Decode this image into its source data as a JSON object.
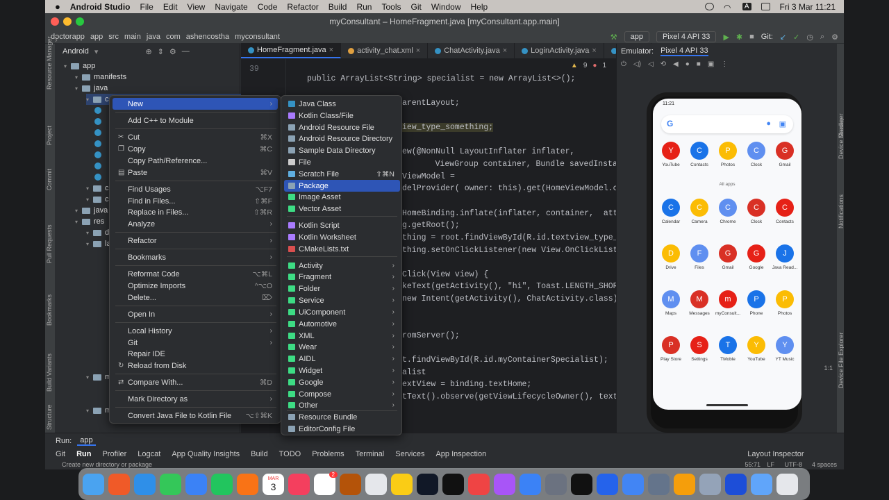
{
  "menubar": {
    "app": "Android Studio",
    "items": [
      "File",
      "Edit",
      "View",
      "Navigate",
      "Code",
      "Refactor",
      "Build",
      "Run",
      "Tools",
      "Git",
      "Window",
      "Help"
    ],
    "clock": "Fri 3 Mar  11:21",
    "input_badge": "A"
  },
  "window": {
    "title": "myConsultant – HomeFragment.java [myConsultant.app.main]"
  },
  "breadcrumb": [
    "doctorapp",
    "app",
    "src",
    "main",
    "java",
    "com",
    "ashencostha",
    "myconsultant"
  ],
  "toolbar": {
    "config": "app",
    "device": "Pixel 4 API 33",
    "git_label": "Git:"
  },
  "project": {
    "view": "Android",
    "rows": [
      {
        "label": "app",
        "indent": 0,
        "kind": "folder"
      },
      {
        "label": "manifests",
        "indent": 1,
        "kind": "folder"
      },
      {
        "label": "java",
        "indent": 1,
        "kind": "folder"
      },
      {
        "label": "co",
        "indent": 2,
        "kind": "folder"
      },
      {
        "label": "co",
        "indent": 2,
        "kind": "folder"
      },
      {
        "label": "co",
        "indent": 2,
        "kind": "folder"
      },
      {
        "label": "java",
        "indent": 1,
        "kind": "folder"
      },
      {
        "label": "res",
        "indent": 1,
        "kind": "folder"
      },
      {
        "label": "dra",
        "indent": 2,
        "kind": "folder"
      },
      {
        "label": "lay",
        "indent": 2,
        "kind": "folder"
      },
      {
        "label": "me",
        "indent": 2,
        "kind": "folder"
      },
      {
        "label": "mi",
        "indent": 2,
        "kind": "folder"
      }
    ],
    "side_labels": [
      "Resource Manager",
      "Project",
      "Commit",
      "Pull Requests",
      "Bookmarks",
      "Build Variants",
      "Structure"
    ]
  },
  "tabs": [
    "HomeFragment.java",
    "activity_chat.xml",
    "ChatActivity.java",
    "LoginActivity.java",
    "Main"
  ],
  "editor": {
    "first_line_no": "39",
    "warnings": "9",
    "errors": "1",
    "lines": [
      "public ArrayList<String> specialist = new ArrayList<>();",
      "arentLayout;",
      "iew_type_something;",
      "ew(@NonNull LayoutInflater inflater,",
      "    ViewGroup container, Bundle savedInstanceState",
      "ViewModel =",
      "delProvider( owner: this).get(HomeViewModel.class)",
      "HomeBinding.inflate(inflater, container,  attachTo",
      "g.getRoot();",
      "thing = root.findViewById(R.id.textview_type_some",
      "thing.setOnClickListener(new View.OnClickListener",
      "Click(View view) {",
      "keText(getActivity(), \"hi\", Toast.LENGTH_SHORT).s",
      "new Intent(getActivity(), ChatActivity.class));",
      "romServer();",
      "t.findViewById(R.id.myContainerSpecialist);",
      "alist",
      "extView = binding.textHome;",
      "tText().observe(getViewLifecycleOwner(), textView"
    ]
  },
  "emulator": {
    "label": "Emulator:",
    "device": "Pixel 4 API 33",
    "right_labels": [
      "Gradle",
      "Device Manager",
      "Notifications",
      "Device File Explorer",
      "Emulator"
    ],
    "zoom": "1:1"
  },
  "phone": {
    "time": "11:21",
    "all_apps": "All apps",
    "apps": [
      [
        "YouTube",
        "Contacts",
        "Photos",
        "Clock",
        "Gmail"
      ],
      [
        "Calendar",
        "Camera",
        "Chrome",
        "Clock",
        "Contacts"
      ],
      [
        "Drive",
        "Files",
        "Gmail",
        "Google",
        "Java Read..."
      ],
      [
        "Maps",
        "Messages",
        "myConsult...",
        "Phone",
        "Photos"
      ],
      [
        "Play Store",
        "Settings",
        "TMoble",
        "YouTube",
        "YT Music"
      ]
    ],
    "colors": [
      "#e62117",
      "#1a73e8",
      "#fbbc04",
      "#5f8ff0",
      "#d93025"
    ]
  },
  "context_menu": {
    "items": [
      {
        "label": "New",
        "shortcut": "",
        "submenu": true,
        "selected": true
      },
      {
        "label": "Add C++ to Module",
        "shortcut": ""
      },
      {
        "label": "Cut",
        "shortcut": "⌘X",
        "icon": "✂"
      },
      {
        "label": "Copy",
        "shortcut": "⌘C",
        "icon": "❐"
      },
      {
        "label": "Copy Path/Reference...",
        "shortcut": ""
      },
      {
        "label": "Paste",
        "shortcut": "⌘V",
        "icon": "▤"
      },
      {
        "label": "Find Usages",
        "shortcut": "⌥F7"
      },
      {
        "label": "Find in Files...",
        "shortcut": "⇧⌘F"
      },
      {
        "label": "Replace in Files...",
        "shortcut": "⇧⌘R"
      },
      {
        "label": "Analyze",
        "shortcut": "",
        "submenu": true
      },
      {
        "label": "Refactor",
        "shortcut": "",
        "submenu": true
      },
      {
        "label": "Bookmarks",
        "shortcut": "",
        "submenu": true
      },
      {
        "label": "Reformat Code",
        "shortcut": "⌥⌘L"
      },
      {
        "label": "Optimize Imports",
        "shortcut": "^⌥O"
      },
      {
        "label": "Delete...",
        "shortcut": "⌦"
      },
      {
        "label": "Open In",
        "shortcut": "",
        "submenu": true
      },
      {
        "label": "Local History",
        "shortcut": "",
        "submenu": true
      },
      {
        "label": "Git",
        "shortcut": "",
        "submenu": true
      },
      {
        "label": "Repair IDE",
        "shortcut": ""
      },
      {
        "label": "Reload from Disk",
        "shortcut": "",
        "icon": "↻"
      },
      {
        "label": "Compare With...",
        "shortcut": "⌘D",
        "icon": "⇄"
      },
      {
        "label": "Mark Directory as",
        "shortcut": "",
        "submenu": true
      },
      {
        "label": "Convert Java File to Kotlin File",
        "shortcut": "⌥⇧⌘K"
      }
    ]
  },
  "new_submenu": {
    "items": [
      {
        "label": "Java Class",
        "icon": "#3592c4"
      },
      {
        "label": "Kotlin Class/File",
        "icon": "#a97bff"
      },
      {
        "label": "Android Resource File",
        "icon": "#8ba2b4"
      },
      {
        "label": "Android Resource Directory",
        "icon": "#8ba2b4"
      },
      {
        "label": "Sample Data Directory",
        "icon": "#8ba2b4"
      },
      {
        "label": "File",
        "icon": "#cccccc"
      },
      {
        "label": "Scratch File",
        "icon": "#5faee0",
        "shortcut": "⇧⌘N"
      },
      {
        "label": "Package",
        "icon": "#8ba2b4",
        "selected": true
      },
      {
        "label": "Image Asset",
        "icon": "#3ddc84"
      },
      {
        "label": "Vector Asset",
        "icon": "#3ddc84"
      },
      {
        "label": "Kotlin Script",
        "icon": "#a97bff"
      },
      {
        "label": "Kotlin Worksheet",
        "icon": "#a97bff"
      },
      {
        "label": "CMakeLists.txt",
        "icon": "#d94f4f"
      },
      {
        "label": "Activity",
        "icon": "#3ddc84",
        "submenu": true
      },
      {
        "label": "Fragment",
        "icon": "#3ddc84",
        "submenu": true
      },
      {
        "label": "Folder",
        "icon": "#3ddc84",
        "submenu": true
      },
      {
        "label": "Service",
        "icon": "#3ddc84",
        "submenu": true
      },
      {
        "label": "UiComponent",
        "icon": "#3ddc84",
        "submenu": true
      },
      {
        "label": "Automotive",
        "icon": "#3ddc84",
        "submenu": true
      },
      {
        "label": "XML",
        "icon": "#3ddc84",
        "submenu": true
      },
      {
        "label": "Wear",
        "icon": "#3ddc84",
        "submenu": true
      },
      {
        "label": "AIDL",
        "icon": "#3ddc84",
        "submenu": true
      },
      {
        "label": "Widget",
        "icon": "#3ddc84",
        "submenu": true
      },
      {
        "label": "Google",
        "icon": "#3ddc84",
        "submenu": true
      },
      {
        "label": "Compose",
        "icon": "#3ddc84",
        "submenu": true
      },
      {
        "label": "Other",
        "icon": "#3ddc84",
        "submenu": true
      },
      {
        "label": "Resource Bundle",
        "icon": "#8ba2b4"
      },
      {
        "label": "EditorConfig File",
        "icon": "#8ba2b4"
      }
    ]
  },
  "run_bar": {
    "label": "Run:",
    "config": "app"
  },
  "bottom_tabs": [
    "Git",
    "Run",
    "Profiler",
    "Logcat",
    "App Quality Insights",
    "Build",
    "TODO",
    "Problems",
    "Terminal",
    "Services",
    "App Inspection",
    "Layout Inspector"
  ],
  "status": {
    "message": "Create new directory or package",
    "position": "55:71",
    "line_sep": "LF",
    "encoding": "UTF-8",
    "indent": "4 spaces"
  },
  "dock": {
    "colors": [
      "#4aa3f0",
      "#f05a28",
      "#2f8fe8",
      "#34c759",
      "#3b82f6",
      "#22c55e",
      "#f97316",
      "#8b5cf6",
      "#f43f5e",
      "#ffffff",
      "#b45309",
      "#e5e7eb",
      "#facc15",
      "#111827",
      "#111111",
      "#ef4444",
      "#a855f7",
      "#3b82f6",
      "#6b7280",
      "#111111",
      "#2563eb",
      "#4285f4",
      "#64748b",
      "#f59e0b",
      "#94a3b8",
      "#1d4ed8",
      "#60a5fa",
      "#e5e7eb"
    ],
    "calendar_month": "MAR",
    "calendar_day": "3",
    "badge": "2"
  }
}
